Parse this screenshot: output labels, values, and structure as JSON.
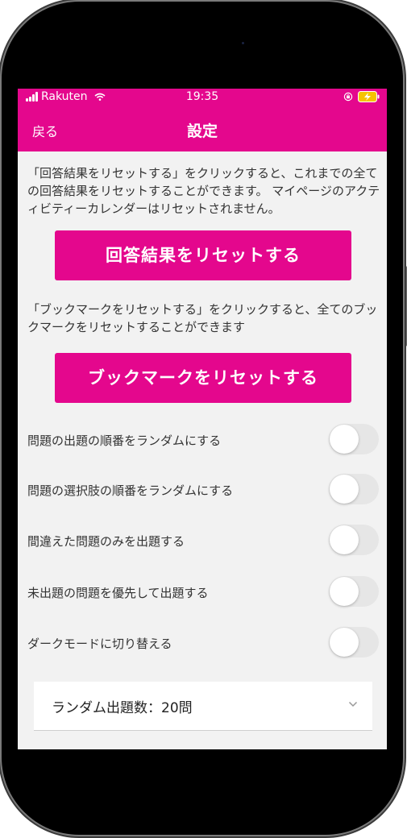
{
  "status_bar": {
    "carrier": "Rakuten",
    "time": "19:35"
  },
  "nav": {
    "back_label": "戻る",
    "title": "設定"
  },
  "reset_results": {
    "description": "「回答結果をリセットする」をクリックすると、これまでの全ての回答結果をリセットすることができます。 マイページのアクティビティーカレンダーはリセットされません。",
    "button_label": "回答結果をリセットする"
  },
  "reset_bookmarks": {
    "description": "「ブックマークをリセットする」をクリックすると、全てのブックマークをリセットすることができます",
    "button_label": "ブックマークをリセットする"
  },
  "toggles": [
    {
      "label": "問題の出題の順番をランダムにする",
      "on": false
    },
    {
      "label": "問題の選択肢の順番をランダムにする",
      "on": false
    },
    {
      "label": "間違えた問題のみを出題する",
      "on": false
    },
    {
      "label": "未出題の問題を優先して出題する",
      "on": false
    },
    {
      "label": "ダークモードに切り替える",
      "on": false
    }
  ],
  "random_count": {
    "selected_label": "ランダム出題数：20問"
  },
  "colors": {
    "accent": "#e4078d",
    "battery_fill": "#f5c400"
  }
}
